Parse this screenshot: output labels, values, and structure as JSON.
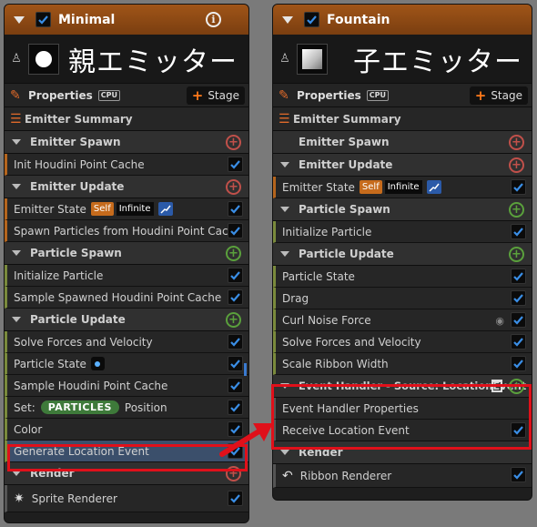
{
  "left": {
    "title": "Minimal",
    "big_label": "親エミッター",
    "properties_label": "Properties",
    "cpu_label": "CPU",
    "stage_label": "Stage",
    "summary_label": "Emitter Summary",
    "sections": {
      "emitter_spawn": "Emitter Spawn",
      "emitter_update": "Emitter Update",
      "particle_spawn": "Particle Spawn",
      "particle_update": "Particle Update",
      "render": "Render"
    },
    "items": {
      "init_houdini": "Init Houdini Point Cache",
      "emitter_state": "Emitter State",
      "self_badge": "Self",
      "infinite_badge": "Infinite",
      "spawn_particles": "Spawn Particles from Houdini Point Cache",
      "initialize_particle": "Initialize Particle",
      "sample_spawned": "Sample Spawned Houdini Point Cache",
      "solve_forces": "Solve Forces and Velocity",
      "particle_state": "Particle State",
      "sample_houdini": "Sample Houdini Point Cache",
      "set_label": "Set:",
      "particles_pill": "PARTICLES",
      "position_label": "Position",
      "color": "Color",
      "generate_location": "Generate Location Event",
      "sprite_renderer": "Sprite Renderer"
    }
  },
  "right": {
    "title": "Fountain",
    "big_label": "子エミッター",
    "properties_label": "Properties",
    "cpu_label": "CPU",
    "stage_label": "Stage",
    "summary_label": "Emitter Summary",
    "sections": {
      "emitter_spawn": "Emitter Spawn",
      "emitter_update": "Emitter Update",
      "particle_spawn": "Particle Spawn",
      "particle_update": "Particle Update",
      "event_handler": "Event Handler - Source: LocationEvent",
      "render": "Render"
    },
    "items": {
      "emitter_state": "Emitter State",
      "self_badge": "Self",
      "infinite_badge": "Infinite",
      "initialize_particle": "Initialize Particle",
      "particle_state": "Particle State",
      "drag": "Drag",
      "curl_noise": "Curl Noise Force",
      "solve_forces": "Solve Forces and Velocity",
      "scale_ribbon": "Scale Ribbon Width",
      "event_handler_props": "Event Handler Properties",
      "receive_location": "Receive Location Event",
      "ribbon_renderer": "Ribbon Renderer"
    }
  },
  "colors": {
    "title_bar": "#8a4714",
    "highlight": "#e0101a",
    "checkbox_check": "#3a8ee6",
    "add_green": "#5aa03c",
    "add_red": "#c0504a"
  }
}
